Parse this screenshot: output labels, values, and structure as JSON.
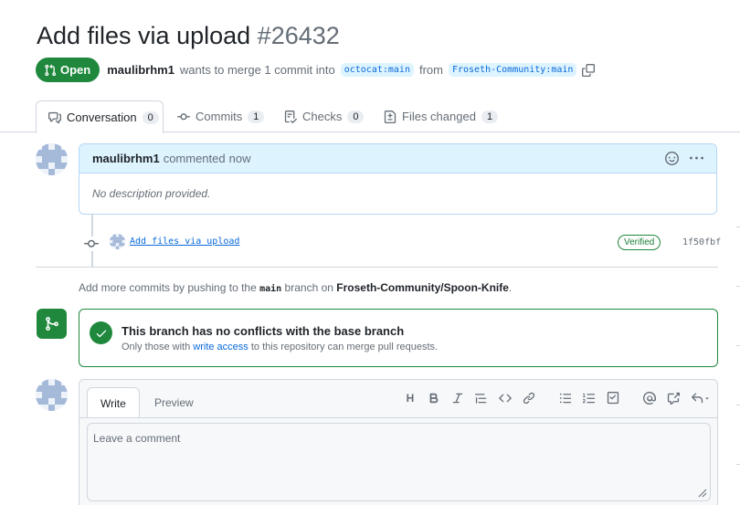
{
  "pr": {
    "title": "Add files via upload",
    "number": "#26432",
    "state": "Open",
    "author": "maulibrhm1",
    "merge_text": "wants to merge 1 commit into",
    "base_ref": "octocat:main",
    "from_text": "from",
    "head_ref": "Froseth-Community:main"
  },
  "tabs": [
    {
      "label": "Conversation",
      "count": "0",
      "icon": "comment-discussion-icon"
    },
    {
      "label": "Commits",
      "count": "1",
      "icon": "commit-icon"
    },
    {
      "label": "Checks",
      "count": "0",
      "icon": "checklist-icon"
    },
    {
      "label": "Files changed",
      "count": "1",
      "icon": "file-diff-icon"
    }
  ],
  "comment": {
    "author": "maulibrhm1",
    "action": "commented",
    "time": "now",
    "body": "No description provided."
  },
  "commit": {
    "message": "Add files via upload",
    "badge": "Verified",
    "sha": "1f50fbf"
  },
  "push_hint": {
    "before": "Add more commits by pushing to the",
    "branch": "main",
    "middle": "branch on",
    "repo": "Froseth-Community/Spoon-Knife",
    "after": "."
  },
  "merge_status": {
    "title": "This branch has no conflicts with the base branch",
    "sub_before": "Only those with",
    "sub_link": "write access",
    "sub_after": "to this repository can merge pull requests."
  },
  "editor": {
    "write_tab": "Write",
    "preview_tab": "Preview",
    "placeholder": "Leave a comment",
    "toolbar_heading": "H"
  },
  "colors": {
    "open_green": "#1f883d",
    "link_blue": "#0969da",
    "comment_header_bg": "#ddf4ff"
  }
}
